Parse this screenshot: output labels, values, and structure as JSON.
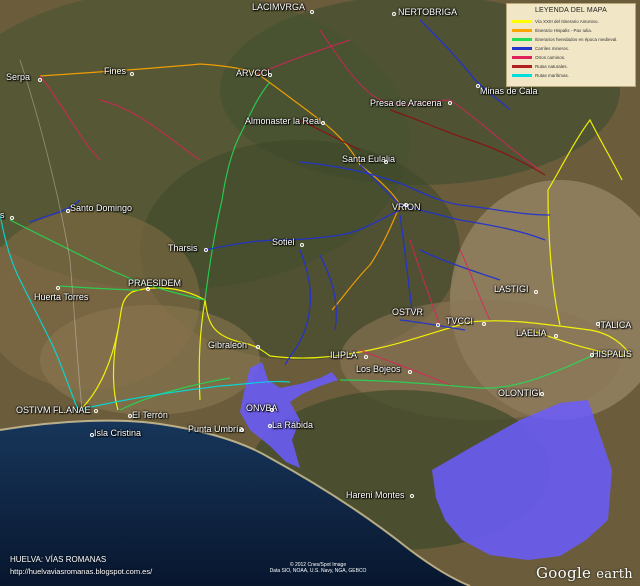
{
  "legend": {
    "title": "LEYENDA DEL MAPA",
    "items": [
      {
        "label": "Vía XXIII del Itinerario Antonino.",
        "color": "#ffff00"
      },
      {
        "label": "Itinerario Hispalis - Pax Iulia.",
        "color": "#ffa500"
      },
      {
        "label": "Itinerarios heredados en época medieval.",
        "color": "#22dd55"
      },
      {
        "label": "Carriles mineros.",
        "color": "#2233cc"
      },
      {
        "label": "Otros caminos.",
        "color": "#e0205a"
      },
      {
        "label": "Rutas naturales.",
        "color": "#b02020"
      },
      {
        "label": "Rutas marítimas.",
        "color": "#00dddd"
      }
    ]
  },
  "places": [
    {
      "name": "LACIMVRGA"
    },
    {
      "name": "NERTOBRIGA"
    },
    {
      "name": "Serpa"
    },
    {
      "name": "Fines"
    },
    {
      "name": "ARVCCI"
    },
    {
      "name": "Minas de Cala"
    },
    {
      "name": "Presa de Aracena"
    },
    {
      "name": "Almonaster la Real"
    },
    {
      "name": "Santa Eulalia"
    },
    {
      "name": "Santo Domingo"
    },
    {
      "name": "VRION"
    },
    {
      "name": "Tharsis"
    },
    {
      "name": "Sotiel"
    },
    {
      "name": "PRAESIDEM"
    },
    {
      "name": "Huerta Torres"
    },
    {
      "name": "LASTIGI"
    },
    {
      "name": "OSTVR"
    },
    {
      "name": "TVCCI"
    },
    {
      "name": "ITALICA"
    },
    {
      "name": "LAELIA"
    },
    {
      "name": "HISPALIS"
    },
    {
      "name": "Gibraleón"
    },
    {
      "name": "ILIPLA"
    },
    {
      "name": "Los Bojeos"
    },
    {
      "name": "OLONTIGI"
    },
    {
      "name": "OSTIVM FL.ANAE"
    },
    {
      "name": "El Terrón"
    },
    {
      "name": "ONVBA"
    },
    {
      "name": "Isla Cristina"
    },
    {
      "name": "Punta Umbría"
    },
    {
      "name": "La Rábida"
    },
    {
      "name": "Hareni Montes"
    },
    {
      "name": "s"
    }
  ],
  "footer": {
    "title": "HUELVA: VÍAS ROMANAS",
    "url": "http://huelvaviasromanas.blogspot.com.es/",
    "credit_line1": "© 2012 Cnes/Spot Image",
    "credit_line2": "Data SIO, NOAA, U.S. Navy, NGA, GEBCO",
    "google": "Google",
    "earth": "earth"
  }
}
